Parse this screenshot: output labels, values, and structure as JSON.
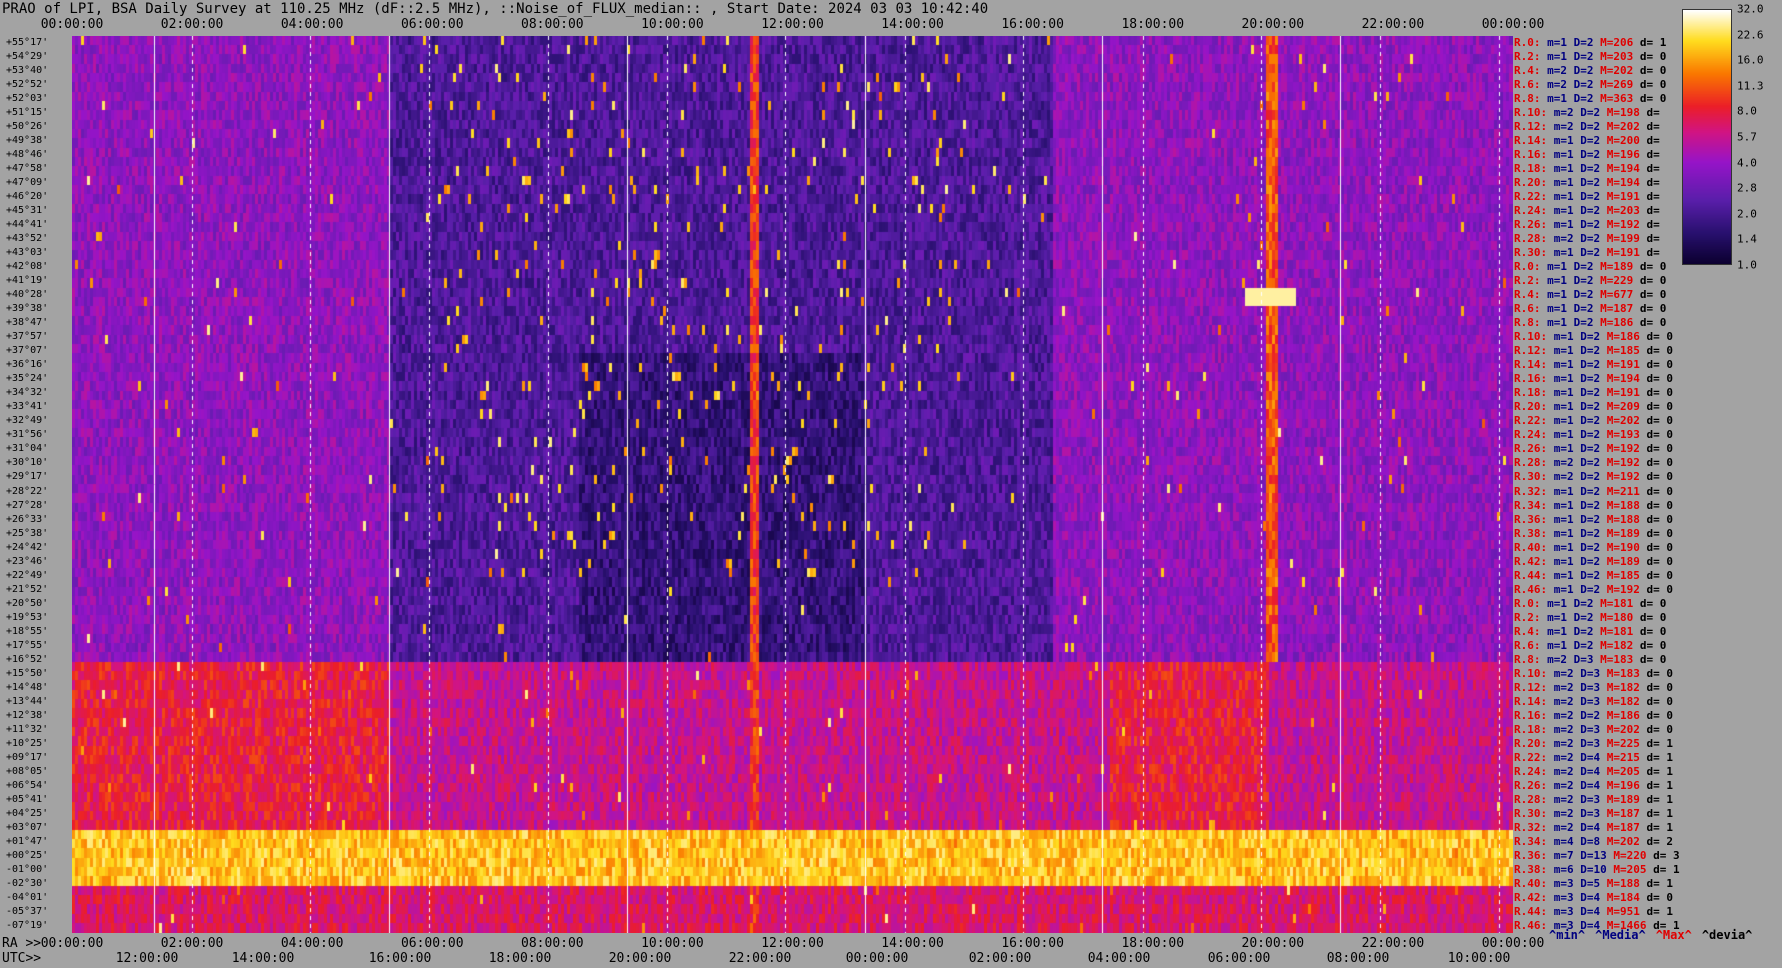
{
  "title": "PRAO of LPI, BSA Daily Survey at 110.25 MHz (dF::2.5 MHz), ::Noise_of_FLUX_median:: , Start Date: 2024 03 03 10:42:40",
  "chart_data": {
    "type": "heatmap",
    "title": "PRAO of LPI, BSA Daily Survey at 110.25 MHz (dF::2.5 MHz), ::Noise_of_FLUX_median:: , Start Date: 2024 03 03 10:42:40",
    "top_axis_ticks": [
      "00:00:00",
      "02:00:00",
      "04:00:00",
      "06:00:00",
      "08:00:00",
      "10:00:00",
      "12:00:00",
      "14:00:00",
      "16:00:00",
      "18:00:00",
      "20:00:00",
      "22:00:00",
      "00:00:00"
    ],
    "ra_axis_prefix": "RA >>",
    "ra_axis_ticks": [
      "00:00:00",
      "02:00:00",
      "04:00:00",
      "06:00:00",
      "08:00:00",
      "10:00:00",
      "12:00:00",
      "14:00:00",
      "16:00:00",
      "18:00:00",
      "20:00:00",
      "22:00:00",
      "00:00:00"
    ],
    "utc_axis_prefix": "UTC>>",
    "utc_axis_ticks": [
      "12:00:00",
      "14:00:00",
      "16:00:00",
      "18:00:00",
      "20:00:00",
      "22:00:00",
      "00:00:00",
      "02:00:00",
      "04:00:00",
      "06:00:00",
      "08:00:00",
      "10:00:00"
    ],
    "declinations": [
      "+55°17'",
      "+54°29'",
      "+53°40'",
      "+52°52'",
      "+52°03'",
      "+51°15'",
      "+50°26'",
      "+49°38'",
      "+48°46'",
      "+47°58'",
      "+47°09'",
      "+46°20'",
      "+45°31'",
      "+44°41'",
      "+43°52'",
      "+43°03'",
      "+42°08'",
      "+41°19'",
      "+40°28'",
      "+39°38'",
      "+38°47'",
      "+37°57'",
      "+37°07'",
      "+36°16'",
      "+35°24'",
      "+34°32'",
      "+33°41'",
      "+32°49'",
      "+31°56'",
      "+31°04'",
      "+30°10'",
      "+29°17'",
      "+28°22'",
      "+27°28'",
      "+26°33'",
      "+25°38'",
      "+24°42'",
      "+23°46'",
      "+22°49'",
      "+21°52'",
      "+20°50'",
      "+19°53'",
      "+18°55'",
      "+17°55'",
      "+16°52'",
      "+15°50'",
      "+14°48'",
      "+13°44'",
      "+12°38'",
      "+11°32'",
      "+10°25'",
      "+09°17'",
      "+08°05'",
      "+06°54'",
      "+05°41'",
      "+04°25'",
      "+03°07'",
      "+01°47'",
      "+00°25'",
      "-01°00'",
      "-02°30'",
      "-04°01'",
      "-05°37'",
      "-07°19'"
    ],
    "colorbar": {
      "ticks": [
        "32.0",
        "22.6",
        "16.0",
        "11.3",
        "8.0",
        "5.7",
        "4.0",
        "2.8",
        "2.0",
        "1.4",
        "1.0"
      ],
      "scale": "log2",
      "range": [
        1.0,
        32.0
      ]
    },
    "stats": [
      {
        "r": "R.0:",
        "m": "m=1",
        "d": "D=2",
        "M": "M=206",
        "dev": "d= 1"
      },
      {
        "r": "R.2:",
        "m": "m=1",
        "d": "D=2",
        "M": "M=203",
        "dev": "d= 0"
      },
      {
        "r": "R.4:",
        "m": "m=2",
        "d": "D=2",
        "M": "M=202",
        "dev": "d= 0"
      },
      {
        "r": "R.6:",
        "m": "m=2",
        "d": "D=2",
        "M": "M=269",
        "dev": "d= 0"
      },
      {
        "r": "R.8:",
        "m": "m=1",
        "d": "D=2",
        "M": "M=363",
        "dev": "d= 0"
      },
      {
        "r": "R.10:",
        "m": "m=2",
        "d": "D=2",
        "M": "M=198",
        "dev": "d="
      },
      {
        "r": "R.12:",
        "m": "m=2",
        "d": "D=2",
        "M": "M=202",
        "dev": "d="
      },
      {
        "r": "R.14:",
        "m": "m=1",
        "d": "D=2",
        "M": "M=200",
        "dev": "d="
      },
      {
        "r": "R.16:",
        "m": "m=1",
        "d": "D=2",
        "M": "M=196",
        "dev": "d="
      },
      {
        "r": "R.18:",
        "m": "m=1",
        "d": "D=2",
        "M": "M=194",
        "dev": "d="
      },
      {
        "r": "R.20:",
        "m": "m=1",
        "d": "D=2",
        "M": "M=194",
        "dev": "d="
      },
      {
        "r": "R.22:",
        "m": "m=1",
        "d": "D=2",
        "M": "M=191",
        "dev": "d="
      },
      {
        "r": "R.24:",
        "m": "m=1",
        "d": "D=2",
        "M": "M=203",
        "dev": "d="
      },
      {
        "r": "R.26:",
        "m": "m=1",
        "d": "D=2",
        "M": "M=192",
        "dev": "d="
      },
      {
        "r": "R.28:",
        "m": "m=2",
        "d": "D=2",
        "M": "M=199",
        "dev": "d="
      },
      {
        "r": "R.30:",
        "m": "m=1",
        "d": "D=2",
        "M": "M=191",
        "dev": "d="
      },
      {
        "r": "R.0:",
        "m": "m=1",
        "d": "D=2",
        "M": "M=189",
        "dev": "d= 0"
      },
      {
        "r": "R.2:",
        "m": "m=1",
        "d": "D=2",
        "M": "M=229",
        "dev": "d= 0"
      },
      {
        "r": "R.4:",
        "m": "m=1",
        "d": "D=2",
        "M": "M=677",
        "dev": "d= 0"
      },
      {
        "r": "R.6:",
        "m": "m=1",
        "d": "D=2",
        "M": "M=187",
        "dev": "d= 0"
      },
      {
        "r": "R.8:",
        "m": "m=1",
        "d": "D=2",
        "M": "M=186",
        "dev": "d= 0"
      },
      {
        "r": "R.10:",
        "m": "m=1",
        "d": "D=2",
        "M": "M=186",
        "dev": "d= 0"
      },
      {
        "r": "R.12:",
        "m": "m=1",
        "d": "D=2",
        "M": "M=185",
        "dev": "d= 0"
      },
      {
        "r": "R.14:",
        "m": "m=1",
        "d": "D=2",
        "M": "M=191",
        "dev": "d= 0"
      },
      {
        "r": "R.16:",
        "m": "m=1",
        "d": "D=2",
        "M": "M=194",
        "dev": "d= 0"
      },
      {
        "r": "R.18:",
        "m": "m=1",
        "d": "D=2",
        "M": "M=191",
        "dev": "d= 0"
      },
      {
        "r": "R.20:",
        "m": "m=1",
        "d": "D=2",
        "M": "M=209",
        "dev": "d= 0"
      },
      {
        "r": "R.22:",
        "m": "m=1",
        "d": "D=2",
        "M": "M=202",
        "dev": "d= 0"
      },
      {
        "r": "R.24:",
        "m": "m=1",
        "d": "D=2",
        "M": "M=193",
        "dev": "d= 0"
      },
      {
        "r": "R.26:",
        "m": "m=1",
        "d": "D=2",
        "M": "M=192",
        "dev": "d= 0"
      },
      {
        "r": "R.28:",
        "m": "m=2",
        "d": "D=2",
        "M": "M=192",
        "dev": "d= 0"
      },
      {
        "r": "R.30:",
        "m": "m=2",
        "d": "D=2",
        "M": "M=192",
        "dev": "d= 0"
      },
      {
        "r": "R.32:",
        "m": "m=1",
        "d": "D=2",
        "M": "M=211",
        "dev": "d= 0"
      },
      {
        "r": "R.34:",
        "m": "m=1",
        "d": "D=2",
        "M": "M=188",
        "dev": "d= 0"
      },
      {
        "r": "R.36:",
        "m": "m=1",
        "d": "D=2",
        "M": "M=188",
        "dev": "d= 0"
      },
      {
        "r": "R.38:",
        "m": "m=1",
        "d": "D=2",
        "M": "M=189",
        "dev": "d= 0"
      },
      {
        "r": "R.40:",
        "m": "m=1",
        "d": "D=2",
        "M": "M=190",
        "dev": "d= 0"
      },
      {
        "r": "R.42:",
        "m": "m=1",
        "d": "D=2",
        "M": "M=189",
        "dev": "d= 0"
      },
      {
        "r": "R.44:",
        "m": "m=1",
        "d": "D=2",
        "M": "M=185",
        "dev": "d= 0"
      },
      {
        "r": "R.46:",
        "m": "m=1",
        "d": "D=2",
        "M": "M=192",
        "dev": "d= 0"
      },
      {
        "r": "R.0:",
        "m": "m=1",
        "d": "D=2",
        "M": "M=181",
        "dev": "d= 0"
      },
      {
        "r": "R.2:",
        "m": "m=1",
        "d": "D=2",
        "M": "M=180",
        "dev": "d= 0"
      },
      {
        "r": "R.4:",
        "m": "m=1",
        "d": "D=2",
        "M": "M=181",
        "dev": "d= 0"
      },
      {
        "r": "R.6:",
        "m": "m=1",
        "d": "D=2",
        "M": "M=182",
        "dev": "d= 0"
      },
      {
        "r": "R.8:",
        "m": "m=2",
        "d": "D=3",
        "M": "M=183",
        "dev": "d= 0"
      },
      {
        "r": "R.10:",
        "m": "m=2",
        "d": "D=3",
        "M": "M=183",
        "dev": "d= 0"
      },
      {
        "r": "R.12:",
        "m": "m=2",
        "d": "D=3",
        "M": "M=182",
        "dev": "d= 0"
      },
      {
        "r": "R.14:",
        "m": "m=2",
        "d": "D=3",
        "M": "M=182",
        "dev": "d= 0"
      },
      {
        "r": "R.16:",
        "m": "m=2",
        "d": "D=2",
        "M": "M=186",
        "dev": "d= 0"
      },
      {
        "r": "R.18:",
        "m": "m=2",
        "d": "D=3",
        "M": "M=202",
        "dev": "d= 0"
      },
      {
        "r": "R.20:",
        "m": "m=2",
        "d": "D=3",
        "M": "M=225",
        "dev": "d= 1"
      },
      {
        "r": "R.22:",
        "m": "m=2",
        "d": "D=4",
        "M": "M=215",
        "dev": "d= 1"
      },
      {
        "r": "R.24:",
        "m": "m=2",
        "d": "D=4",
        "M": "M=205",
        "dev": "d= 1"
      },
      {
        "r": "R.26:",
        "m": "m=2",
        "d": "D=4",
        "M": "M=196",
        "dev": "d= 1"
      },
      {
        "r": "R.28:",
        "m": "m=2",
        "d": "D=3",
        "M": "M=189",
        "dev": "d= 1"
      },
      {
        "r": "R.30:",
        "m": "m=2",
        "d": "D=3",
        "M": "M=187",
        "dev": "d= 1"
      },
      {
        "r": "R.32:",
        "m": "m=2",
        "d": "D=4",
        "M": "M=187",
        "dev": "d= 1"
      },
      {
        "r": "R.34:",
        "m": "m=4",
        "d": "D=8",
        "M": "M=202",
        "dev": "d= 2"
      },
      {
        "r": "R.36:",
        "m": "m=7",
        "d": "D=13",
        "M": "M=220",
        "dev": "d= 3"
      },
      {
        "r": "R.38:",
        "m": "m=6",
        "d": "D=10",
        "M": "M=205",
        "dev": "d= 1"
      },
      {
        "r": "R.40:",
        "m": "m=3",
        "d": "D=5",
        "M": "M=188",
        "dev": "d= 1"
      },
      {
        "r": "R.42:",
        "m": "m=3",
        "d": "D=4",
        "M": "M=184",
        "dev": "d= 0"
      },
      {
        "r": "R.44:",
        "m": "m=3",
        "d": "D=4",
        "M": "M=951",
        "dev": "d= 1"
      },
      {
        "r": "R.46:",
        "m": "m=3",
        "d": "D=4",
        "M": "M=1466",
        "dev": "d= 1"
      }
    ],
    "footer_labels": [
      {
        "text": "^min^",
        "color": "#000080"
      },
      {
        "text": "^Media^",
        "color": "#000080"
      },
      {
        "text": "^Max^",
        "color": "#e00000"
      },
      {
        "text": "^devia^",
        "color": "#000000"
      }
    ]
  }
}
